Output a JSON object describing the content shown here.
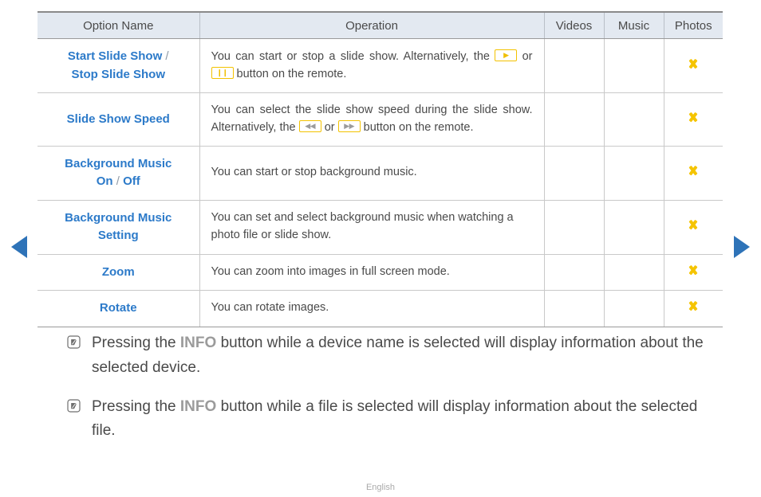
{
  "nav": {
    "prev_label": "Previous page",
    "next_label": "Next page"
  },
  "table": {
    "headers": {
      "option_name": "Option Name",
      "operation": "Operation",
      "videos": "Videos",
      "music": "Music",
      "photos": "Photos"
    },
    "rows": [
      {
        "name_part1": "Start Slide Show",
        "separator": "/",
        "name_part2": "Stop Slide Show",
        "op_before": "You can start or stop a slide show. Alternatively, the",
        "key1": "▶",
        "op_middle": "or",
        "key2": "❙❙",
        "op_after": "button on the remote.",
        "videos": "",
        "music": "",
        "photos": "chevron-down-icon"
      },
      {
        "name_part1": "Slide Show Speed",
        "separator": "",
        "name_part2": "",
        "op_before": "You can select the slide show speed during the slide show. Alternatively, the",
        "key1": "◀◀",
        "op_middle": "or",
        "key2": "▶▶",
        "op_after": "button on the remote.",
        "videos": "",
        "music": "",
        "photos": "chevron-down-icon"
      },
      {
        "name_part1": "Background Music",
        "separator": "/",
        "name_part2": "On",
        "name_part3": "Off",
        "op_before": "You can start or stop background music.",
        "key1": "",
        "op_middle": "",
        "key2": "",
        "op_after": "",
        "videos": "",
        "music": "",
        "photos": "chevron-down-icon"
      },
      {
        "name_part1": "Background Music",
        "separator": "",
        "name_part2": "Setting",
        "op_before": "You can set and select background music when watching a photo file or slide show.",
        "key1": "",
        "op_middle": "",
        "key2": "",
        "op_after": "",
        "videos": "",
        "music": "",
        "photos": "chevron-down-icon"
      },
      {
        "name_part1": "Zoom",
        "separator": "",
        "name_part2": "",
        "op_before": "You can zoom into images in full screen mode.",
        "key1": "",
        "op_middle": "",
        "key2": "",
        "op_after": "",
        "videos": "",
        "music": "",
        "photos": "chevron-down-icon"
      },
      {
        "name_part1": "Rotate",
        "separator": "",
        "name_part2": "",
        "op_before": "You can rotate images.",
        "key1": "",
        "op_middle": "",
        "key2": "",
        "op_after": "",
        "videos": "",
        "music": "",
        "photos": "chevron-down-icon"
      }
    ]
  },
  "notes": [
    {
      "icon": "note-icon",
      "before": "Pressing the ",
      "highlight": "INFO",
      "after": " button while a device name is selected will display information about the selected device."
    },
    {
      "icon": "note-icon",
      "before": "Pressing the ",
      "highlight": "INFO",
      "after": " button while a file is selected will display information about the selected file."
    }
  ],
  "footer": {
    "language": "English"
  },
  "colors": {
    "option_blue": "#2c7ac9",
    "chevron_yellow": "#f5c400",
    "key_border": "#f3c200",
    "header_bg": "#e3e9f1",
    "nav_blue": "#2e73b8"
  }
}
